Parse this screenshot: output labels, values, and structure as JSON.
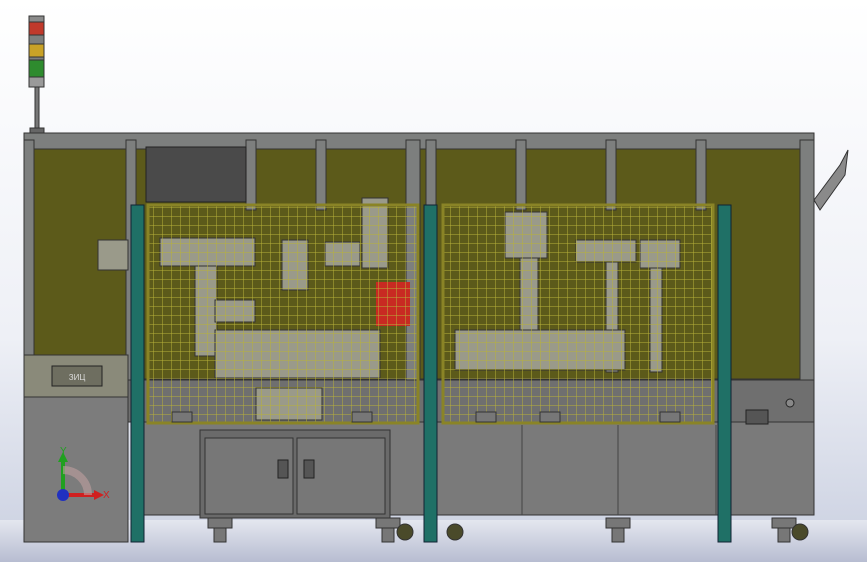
{
  "viewport": {
    "view": "front",
    "background_top": "#ffffff",
    "background_bottom": "#c9cfe0"
  },
  "model": {
    "frame_color": "#7d7f7e",
    "panel_color": "#5c5a1a",
    "mesh_color": "#b8b23a",
    "post_color": "#1f7066",
    "base_color": "#7a7a7a",
    "accent_red": "#c82a22"
  },
  "signal_tower": {
    "lights": [
      "red",
      "yellow",
      "green"
    ],
    "colors": [
      "#c0392b",
      "#c9a227",
      "#2e8b2e"
    ]
  },
  "triad": {
    "x_label": "X",
    "y_label": "Y",
    "x_color": "#d02020",
    "y_color": "#20a020",
    "z_color": "#2030c0"
  },
  "labels": {
    "panel_text": "ЗИЦ"
  }
}
